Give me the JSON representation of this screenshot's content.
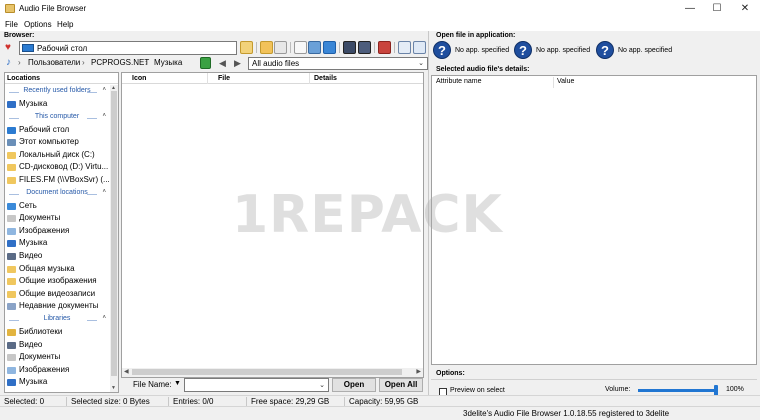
{
  "window": {
    "title": "Audio File Browser"
  },
  "menu": [
    "File",
    "Options",
    "Help"
  ],
  "browser": {
    "caption": "Browser:",
    "current_folder": "Рабочий стол",
    "breadcrumb": [
      "Пользователи",
      "PCPROGS.NET",
      "Музыка"
    ],
    "filter": "All audio files"
  },
  "locations": {
    "header": "Locations",
    "groups": [
      {
        "title": "Recently used folders",
        "items": [
          "Музыка"
        ]
      },
      {
        "title": "This computer",
        "items": [
          "Рабочий стол",
          "Этот компьютер",
          "Локальный диск (C:)",
          "CD-дисковод (D:) Virtu...",
          "FILES.FM (\\\\VBoxSvr) (..."
        ]
      },
      {
        "title": "Document locations",
        "items": [
          "Сеть",
          "Документы",
          "Изображения",
          "Музыка",
          "Видео",
          "Общая музыка",
          "Общие изображения",
          "Общие видеозаписи",
          "Недавние документы"
        ]
      },
      {
        "title": "Libraries",
        "items": [
          "Библиотеки",
          "Видео",
          "Документы",
          "Изображения",
          "Музыка"
        ]
      }
    ]
  },
  "file_list": {
    "columns": [
      "Icon",
      "File",
      "Details"
    ]
  },
  "file_name": {
    "label": "File Name:",
    "value": "",
    "open_button": "Open",
    "open_all_button": "Open All"
  },
  "open_in": {
    "caption": "Open file in application:",
    "slots": [
      "No app. specified",
      "No app. specified",
      "No app. specified"
    ]
  },
  "details": {
    "caption": "Selected audio file's details:",
    "columns": [
      "Attribute name",
      "Value"
    ]
  },
  "options": {
    "caption": "Options:",
    "preview_label": "Preview on select",
    "preview_checked": false,
    "volume_label": "Volume:",
    "volume_percent": 100,
    "volume_text": "100%"
  },
  "status": {
    "selected": "Selected: 0",
    "selected_size": "Selected size: 0 Bytes",
    "entries": "Entries: 0/0",
    "free_space": "Free space: 29,29 GB",
    "capacity": "Capacity: 59,95 GB",
    "credit": "3delite's Audio File Browser 1.0.18.55 registered to 3delite"
  },
  "watermark": "1REPACK",
  "colors": {
    "accent": "#2176d2",
    "question_icon": "#1f4e9e",
    "group_text": "#2659a8",
    "favorite": "#d0312d"
  }
}
